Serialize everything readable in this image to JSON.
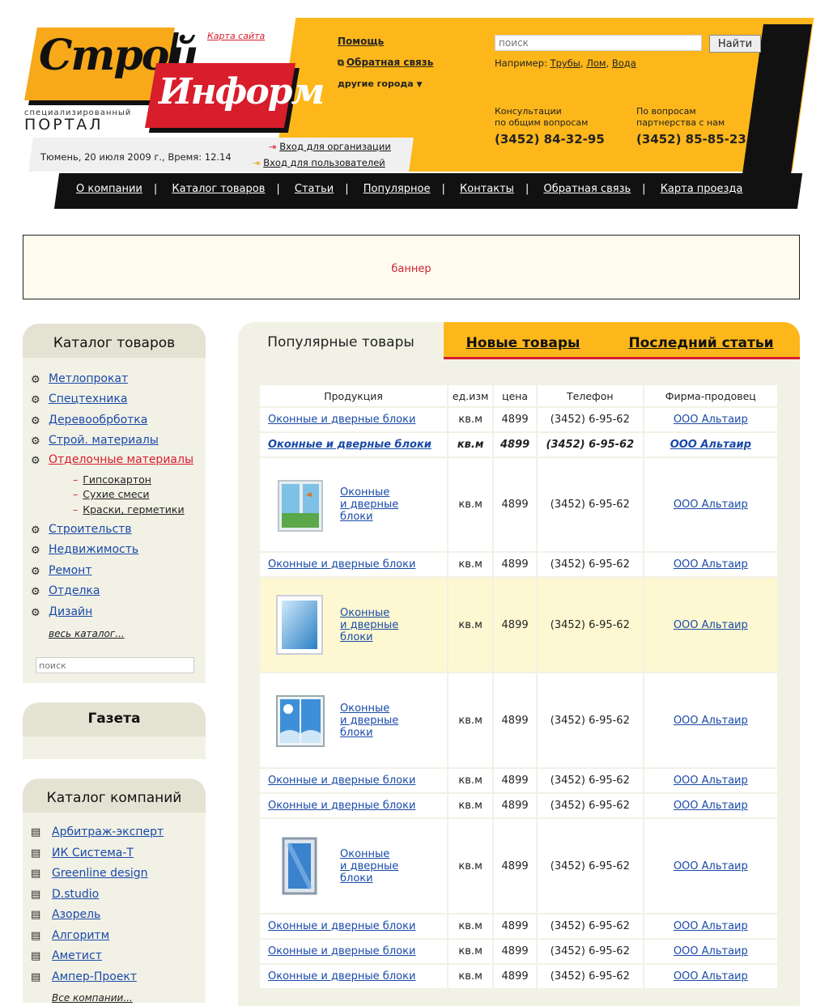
{
  "header": {
    "logo_top": "Строй",
    "logo_bottom": "Информ",
    "tagline_small": "специализированный",
    "tagline_big": "ПОРТАЛ",
    "sitemap": "Карта сайта",
    "help": "Помощь",
    "feedback": "Обратная связь",
    "cities": "другие города",
    "search_placeholder": "поиск",
    "search_button": "Найти",
    "example_label": "Например:",
    "examples": [
      "Трубы",
      "Лом",
      "Вода"
    ],
    "date_text": "Тюмень, 20 июля 2009 г.,  Время: 12.14",
    "login_org": "Вход для организации",
    "login_user": "Вход для пользователей",
    "contact1_line1": "Консультации",
    "contact1_line2": "по общим вопросам",
    "contact1_phone": "(3452) 84-32-95",
    "contact2_line1": "По вопросам",
    "contact2_line2": "партнерства с нам",
    "contact2_phone": "(3452) 85-85-23"
  },
  "nav": [
    "О компании",
    "Каталог товаров",
    "Статьи",
    "Популярное",
    "Контакты",
    "Обратная связь",
    "Карта проезда"
  ],
  "banner": "баннер",
  "catalog": {
    "title": "Каталог товаров",
    "items": [
      "Метлопрокат",
      "Спецтехника",
      "Деревообрботка",
      "Строй. материалы",
      "Отделочные материалы"
    ],
    "subitems": [
      "Гипсокартон",
      "Сухие смеси",
      "Краски, герметики"
    ],
    "items2": [
      "Строительств",
      "Недвижимость",
      "Ремонт",
      "Отделка",
      "Дизайн"
    ],
    "all": "весь каталог...",
    "search_placeholder": "поиск"
  },
  "gazeta": {
    "title": "Газета"
  },
  "companies": {
    "title": "Каталог компаний",
    "items": [
      "Арбитраж-эксперт",
      "ИК Система-Т",
      "Greenline design",
      "D.studio",
      "Азорель",
      "Алгоритм",
      "Аметист",
      "Ампер-Проект"
    ],
    "all": "Все компании..."
  },
  "tabs": {
    "popular": "Популярные товары",
    "new": "Новые товары",
    "articles": "Последний статьи"
  },
  "table": {
    "headers": [
      "Продукция",
      "ед.изм",
      "цена",
      "Телефон",
      "Фирма-продовец"
    ],
    "product": "Оконные и дверные блоки",
    "product_l1": "Оконные",
    "product_l2": "и дверные",
    "product_l3": "блоки",
    "unit": "кв.м",
    "price": "4899",
    "phone": "(3452) 6-95-62",
    "firm": "ООО Альтаир"
  },
  "colors": {
    "accent_yellow": "#fdb71b",
    "accent_red": "#d81d2b",
    "panel": "#f2f1e6"
  }
}
